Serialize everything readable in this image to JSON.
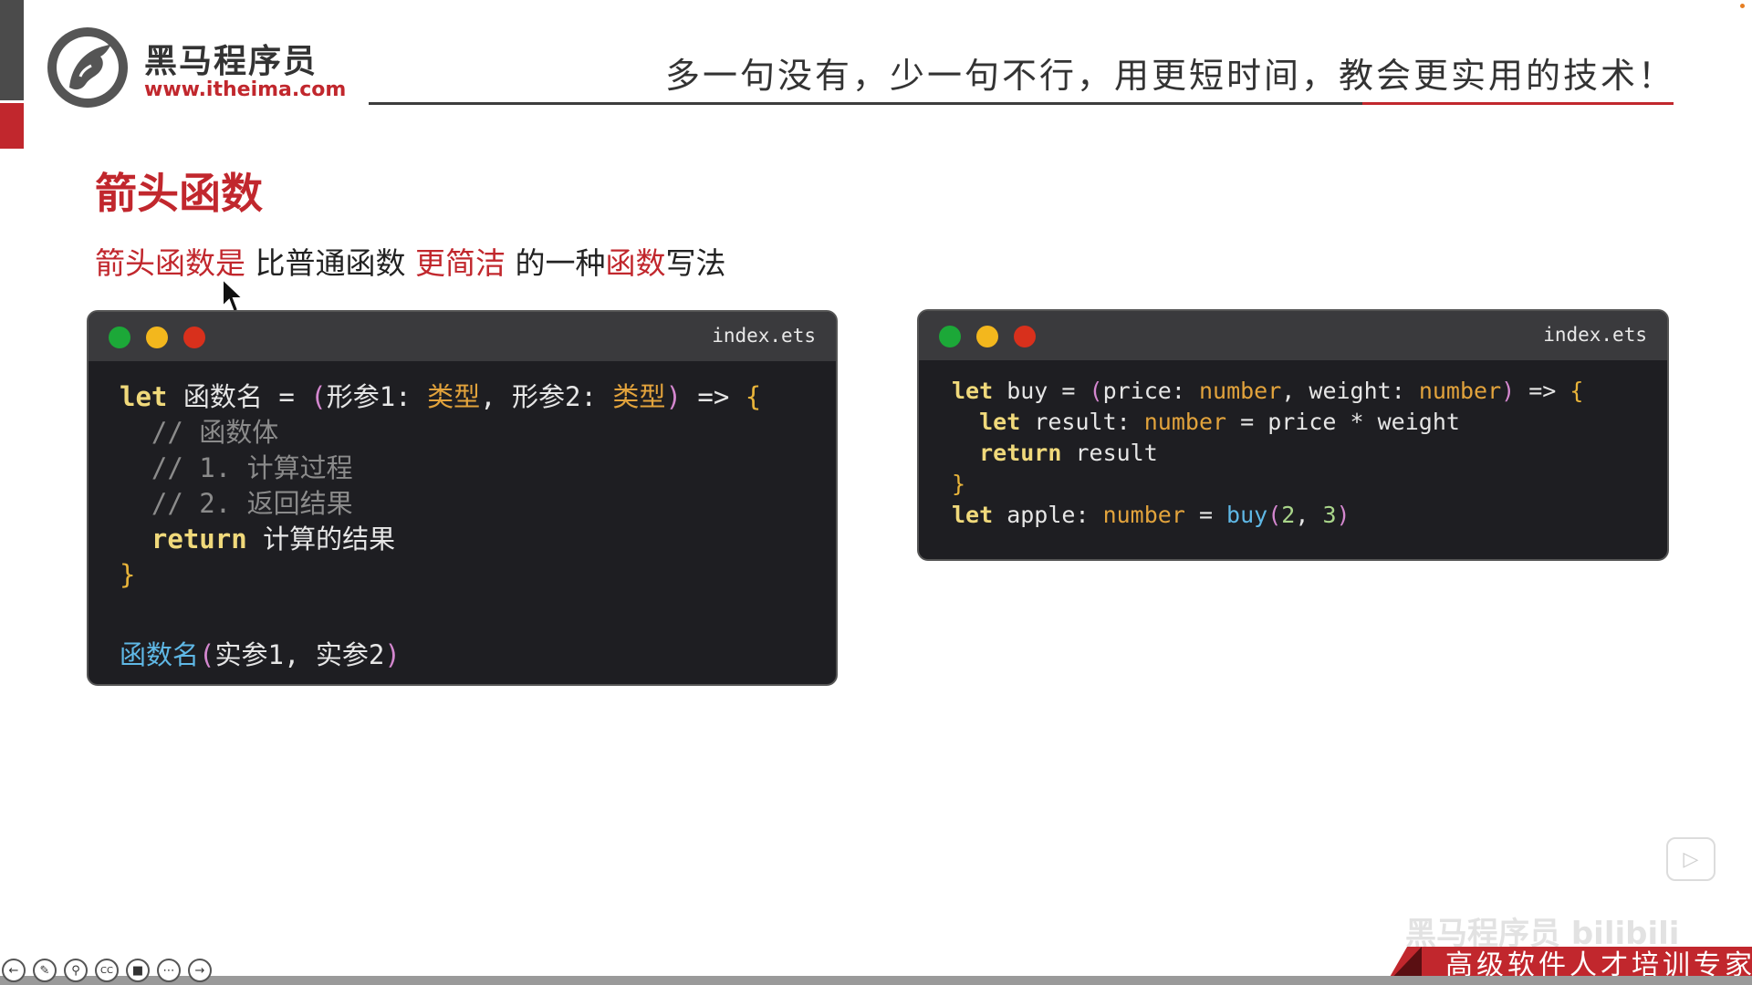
{
  "header": {
    "logo_title": "黑马程序员",
    "logo_url": "www.itheima.com",
    "slogan": "多一句没有，少一句不行，用更短时间，教会更实用的技术！"
  },
  "slide": {
    "heading": "箭头函数",
    "description": {
      "part1": "箭头函数是",
      "part2": " 比普通函数 ",
      "part3": "更简洁",
      "part4": " 的一种",
      "part5": "函数",
      "part6": "写法"
    }
  },
  "code_left": {
    "filename": "index.ets",
    "lines": {
      "l1_kw": "let",
      "l1_name": " 函数名 ",
      "l1_eq": "= ",
      "l1_po": "(",
      "l1_p1": "形参1",
      "l1_c1": ": ",
      "l1_t1": "类型",
      "l1_comma": ", ",
      "l1_p2": "形参2",
      "l1_c2": ": ",
      "l1_t2": "类型",
      "l1_pc": ")",
      "l1_arrow": " => ",
      "l1_brace": "{",
      "l2": "  // 函数体",
      "l3": "  // 1. 计算过程",
      "l4": "  // 2. 返回结果",
      "l5_kw": "  return",
      "l5_rest": " 计算的结果",
      "l6": "}",
      "l8_fn": "函数名",
      "l8_po": "(",
      "l8_args": "实参1, 实参2",
      "l8_pc": ")"
    }
  },
  "code_right": {
    "filename": "index.ets",
    "lines": {
      "r1_kw": "let",
      "r1_name": " buy ",
      "r1_eq": "= ",
      "r1_po": "(",
      "r1_p1": "price",
      "r1_c1": ": ",
      "r1_t1": "number",
      "r1_comma": ", ",
      "r1_p2": "weight",
      "r1_c2": ": ",
      "r1_t2": "number",
      "r1_pc": ")",
      "r1_arrow": " => ",
      "r1_brace": "{",
      "r2_kw": "  let",
      "r2_name": " result",
      "r2_colon": ": ",
      "r2_t": "number",
      "r2_rest": " = price * weight",
      "r3_kw": "  return",
      "r3_rest": " result",
      "r4": "}",
      "r5_kw": "let",
      "r5_name": " apple",
      "r5_colon": ": ",
      "r5_t": "number",
      "r5_eq": " = ",
      "r5_fn": "buy",
      "r5_po": "(",
      "r5_a1": "2",
      "r5_comma": ", ",
      "r5_a2": "3",
      "r5_pc": ")"
    }
  },
  "footer": {
    "ribbon_text": "高级软件人才培训专家",
    "watermark": "黑马程序员 bilibili"
  },
  "toolbar": {
    "icons": [
      "back-icon",
      "pen-icon",
      "zoom-icon",
      "cc-icon",
      "camera-icon",
      "more-icon",
      "forward-icon"
    ]
  }
}
